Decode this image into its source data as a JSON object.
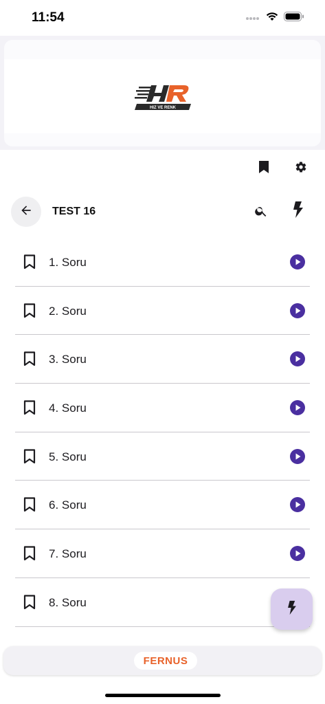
{
  "status_bar": {
    "time": "11:54"
  },
  "banner": {
    "logo_text": "HIZ VE RENK",
    "logo_mark": "HR"
  },
  "header": {
    "title": "TEST 16"
  },
  "questions": [
    {
      "label": "1. Soru"
    },
    {
      "label": "2. Soru"
    },
    {
      "label": "3. Soru"
    },
    {
      "label": "4. Soru"
    },
    {
      "label": "5. Soru"
    },
    {
      "label": "6. Soru"
    },
    {
      "label": "7. Soru"
    },
    {
      "label": "8. Soru"
    }
  ],
  "footer": {
    "brand": "FERNUS"
  },
  "colors": {
    "accent": "#4a2fa0",
    "fab_bg": "#d9cdee",
    "brand_orange": "#e8622a"
  },
  "icons": {
    "bookmark_filled": "bookmark-filled-icon",
    "settings": "gear-icon",
    "back": "arrow-left-icon",
    "search": "search-icon",
    "bolt": "bolt-icon",
    "bookmark_outline": "bookmark-outline-icon",
    "play": "play-circle-icon"
  }
}
